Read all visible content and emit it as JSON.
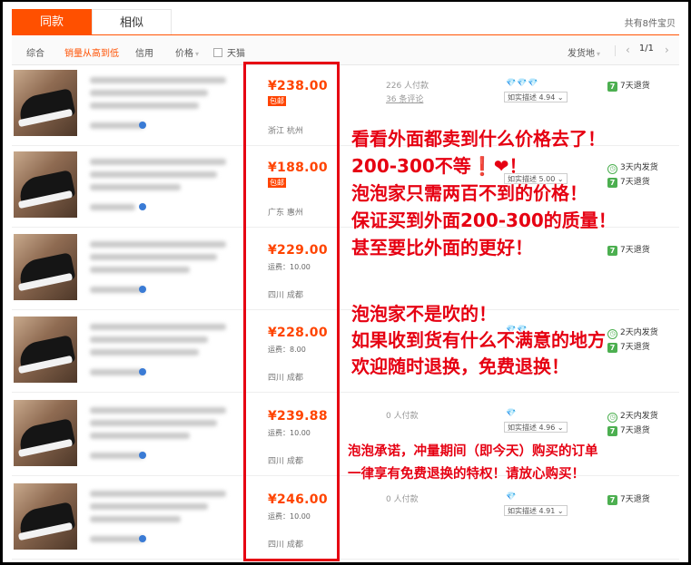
{
  "tabs": [
    {
      "label": "同款",
      "active": true
    },
    {
      "label": "相似",
      "active": false
    }
  ],
  "total_label": "共有8件宝贝",
  "filters": {
    "default_label": "综合",
    "sales_label": "销量从高到低",
    "credit_label": "信用",
    "price_label": "价格",
    "tmall_label": "天猫",
    "ship_from_label": "发货地",
    "page_indicator": "1/1",
    "prev_label": "‹",
    "next_label": "›"
  },
  "products": [
    {
      "price": "¥238.00",
      "badge": "包邮",
      "shipping": "",
      "location": "浙江 杭州",
      "paid": "226 人付款",
      "reviews": "36 条评论",
      "gems": "💎💎💎",
      "rating": "如实描述 4.94",
      "services": [
        "7天退货"
      ],
      "service_icons": [
        "7"
      ]
    },
    {
      "price": "¥188.00",
      "badge": "包邮",
      "shipping": "",
      "location": "广东 惠州",
      "paid": "",
      "reviews": "",
      "gems": "",
      "rating": "如实描述 5.00",
      "services": [
        "3天内发货",
        "7天退货"
      ],
      "service_icons": [
        "clock",
        "7"
      ]
    },
    {
      "price": "¥229.00",
      "badge": "",
      "shipping": "运费：10.00",
      "location": "四川 成都",
      "paid": "",
      "reviews": "",
      "gems": "",
      "rating": "",
      "services": [
        "7天退货"
      ],
      "service_icons": [
        "7"
      ]
    },
    {
      "price": "¥228.00",
      "badge": "",
      "shipping": "运费：8.00",
      "location": "四川 成都",
      "paid": "",
      "reviews": "",
      "gems": "💎💎",
      "rating": "",
      "services": [
        "2天内发货",
        "7天退货"
      ],
      "service_icons": [
        "clock",
        "7"
      ]
    },
    {
      "price": "¥239.88",
      "badge": "",
      "shipping": "运费：10.00",
      "location": "四川 成都",
      "paid": "0 人付款",
      "reviews": "",
      "gems": "💎",
      "rating": "如实描述 4.96",
      "services": [
        "2天内发货",
        "7天退货"
      ],
      "service_icons": [
        "clock",
        "7"
      ]
    },
    {
      "price": "¥246.00",
      "badge": "",
      "shipping": "运费：10.00",
      "location": "四川 成都",
      "paid": "0 人付款",
      "reviews": "",
      "gems": "💎",
      "rating": "如实描述 4.91",
      "services": [
        "7天退货"
      ],
      "service_icons": [
        "7"
      ]
    }
  ],
  "annotations": {
    "line1": "看看外面都卖到什么价格去了！",
    "line2": "200-300不等❗❤！",
    "line3": "泡泡家只需两百不到的价格！",
    "line4": "保证买到外面200-300的质量！",
    "line5": "甚至要比外面的更好！",
    "line6": "泡泡家不是吹的！",
    "line7": "如果收到货有什么不满意的地方",
    "line8": "欢迎随时退换，免费退换！",
    "line9": "泡泡承诺，冲量期间（即今天）购买的订单",
    "line10": "一律享有免费退换的特权！请放心购买！"
  },
  "colors": {
    "accent": "#ff5000",
    "price": "#ff4400",
    "highlight": "#e60012",
    "service": "#4caf50"
  }
}
